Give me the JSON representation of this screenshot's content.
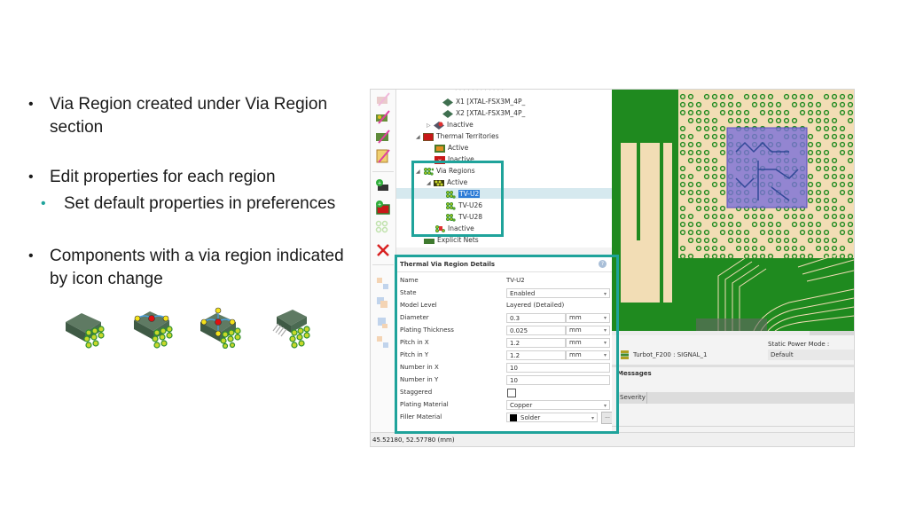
{
  "slide": {
    "bullets": [
      {
        "level": 1,
        "text": "Via Region created under Via Region section"
      },
      {
        "level": 1,
        "text": "Edit properties for each region"
      },
      {
        "level": 2,
        "text": "Set default properties in preferences"
      },
      {
        "level": 1,
        "text": "Components with a via region indicated by icon change"
      }
    ],
    "icons": [
      "chip-with-vias-icon",
      "chip-with-two-pins-vias-icon",
      "chip-with-four-pins-vias-icon",
      "chip-with-leads-vias-icon"
    ],
    "accent_color": "#1fa39b"
  },
  "tree": {
    "items": [
      {
        "label": "X1 [XTAL-FSX3M_4P_",
        "level": 3,
        "icon": "component-icon"
      },
      {
        "label": "X2 [XTAL-FSX3M_4P_",
        "level": 3,
        "icon": "component-icon"
      },
      {
        "label": "Inactive",
        "level": 2,
        "icon": "inactive-component-icon",
        "expander": "collapsed"
      },
      {
        "label": "Thermal Territories",
        "level": 1,
        "icon": "thermal-territory-icon",
        "expander": "expanded"
      },
      {
        "label": "Active",
        "level": 2,
        "icon": "territory-active-icon"
      },
      {
        "label": "Inactive",
        "level": 2,
        "icon": "territory-inactive-icon"
      },
      {
        "label": "Via Regions",
        "level": 1,
        "icon": "via-region-icon",
        "expander": "expanded"
      },
      {
        "label": "Active",
        "level": 2,
        "icon": "via-active-icon",
        "expander": "expanded"
      },
      {
        "label": "TV-U2",
        "level": 3,
        "icon": "via-region-icon",
        "selected": true
      },
      {
        "label": "TV-U26",
        "level": 3,
        "icon": "via-region-icon"
      },
      {
        "label": "TV-U28",
        "level": 3,
        "icon": "via-region-icon"
      },
      {
        "label": "Inactive",
        "level": 2,
        "icon": "via-inactive-icon"
      },
      {
        "label": "Explicit Nets",
        "level": 1,
        "icon": "explicit-nets-icon"
      }
    ]
  },
  "details": {
    "title": "Thermal Via Region Details",
    "help_glyph": "?",
    "properties": [
      {
        "label": "Name",
        "value": "TV-U2",
        "type": "text"
      },
      {
        "label": "State",
        "value": "Enabled",
        "type": "dropdown"
      },
      {
        "label": "Model Level",
        "value": "Layered (Detailed)",
        "type": "text"
      },
      {
        "label": "Diameter",
        "value": "0.3",
        "unit": "mm",
        "type": "number-unit"
      },
      {
        "label": "Plating Thickness",
        "value": "0.025",
        "unit": "mm",
        "type": "number-unit"
      },
      {
        "label": "Pitch in X",
        "value": "1.2",
        "unit": "mm",
        "type": "number-unit"
      },
      {
        "label": "Pitch in Y",
        "value": "1.2",
        "unit": "mm",
        "type": "number-unit"
      },
      {
        "label": "Number in X",
        "value": "10",
        "type": "input"
      },
      {
        "label": "Number in Y",
        "value": "10",
        "type": "input"
      },
      {
        "label": "Staggered",
        "value": false,
        "type": "checkbox"
      },
      {
        "label": "Plating Material",
        "value": "Copper",
        "type": "dropdown"
      },
      {
        "label": "Filler Material",
        "value": "Solder",
        "type": "dropdown-swatch",
        "swatch_color": "#000000",
        "button": "..."
      }
    ]
  },
  "lower_panel": {
    "model_label": "Turbot_F200 : SIGNAL_1",
    "static_power_label": "Static Power Mode :",
    "static_power_value": "Default",
    "messages_title": "Messages",
    "severity_header": "Severity"
  },
  "status_bar": {
    "coordinates": "45.52180, 52.57780 (mm)"
  },
  "colors": {
    "pcb_green": "#1f8a1f",
    "pcb_copper": "#f2ddb5",
    "via_region_overlay": "#7a6fd8",
    "selection": "#2b7bd6",
    "highlight_box": "#1fa39b"
  }
}
